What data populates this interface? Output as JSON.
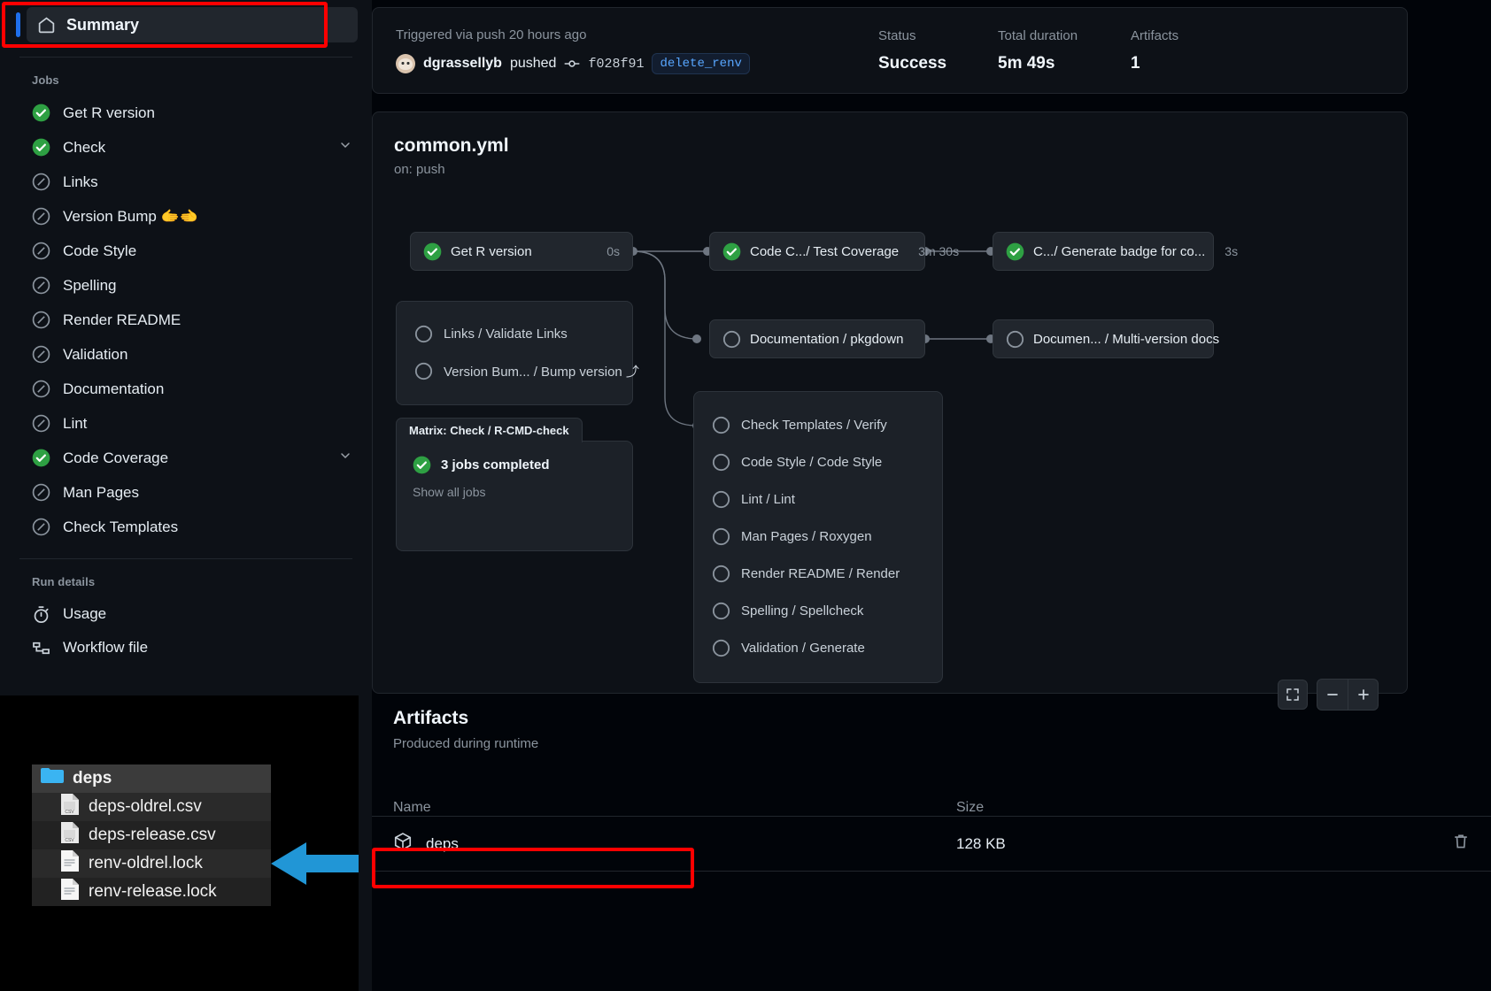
{
  "sidebar": {
    "summary": {
      "label": "Summary",
      "icon": "home-icon"
    },
    "jobs_heading": "Jobs",
    "jobs": [
      {
        "label": "Get R version",
        "status": "success",
        "expandable": false
      },
      {
        "label": "Check",
        "status": "success",
        "expandable": true
      },
      {
        "label": "Links",
        "status": "skipped",
        "expandable": false
      },
      {
        "label": "Version Bump 🫱🫲",
        "status": "skipped",
        "expandable": false
      },
      {
        "label": "Code Style",
        "status": "skipped",
        "expandable": false
      },
      {
        "label": "Spelling",
        "status": "skipped",
        "expandable": false
      },
      {
        "label": "Render README",
        "status": "skipped",
        "expandable": false
      },
      {
        "label": "Validation",
        "status": "skipped",
        "expandable": false
      },
      {
        "label": "Documentation",
        "status": "skipped",
        "expandable": false
      },
      {
        "label": "Lint",
        "status": "skipped",
        "expandable": false
      },
      {
        "label": "Code Coverage",
        "status": "success",
        "expandable": true
      },
      {
        "label": "Man Pages",
        "status": "skipped",
        "expandable": false
      },
      {
        "label": "Check Templates",
        "status": "skipped",
        "expandable": false
      }
    ],
    "run_details_heading": "Run details",
    "run_details": [
      {
        "label": "Usage",
        "icon": "stopwatch-icon"
      },
      {
        "label": "Workflow file",
        "icon": "workflow-file-icon"
      }
    ]
  },
  "finder": {
    "rows": [
      {
        "name": "deps",
        "type": "folder",
        "depth": 0
      },
      {
        "name": "deps-oldrel.csv",
        "type": "csv",
        "depth": 1
      },
      {
        "name": "deps-release.csv",
        "type": "csv",
        "depth": 1
      },
      {
        "name": "renv-oldrel.lock",
        "type": "file",
        "depth": 1
      },
      {
        "name": "renv-release.lock",
        "type": "file",
        "depth": 1
      }
    ]
  },
  "header": {
    "triggered": "Triggered via push 20 hours ago",
    "user": "dgrassellyb",
    "pushed_verb": "pushed",
    "commit_sha": "f028f91",
    "branch": "delete_renv",
    "status_label": "Status",
    "status_value": "Success",
    "duration_label": "Total duration",
    "duration_value": "5m 49s",
    "artifacts_label": "Artifacts",
    "artifacts_value": "1"
  },
  "workflow": {
    "file": "common.yml",
    "trigger": "on: push",
    "nodes": [
      {
        "id": "get-r-version",
        "label": "Get R version",
        "duration": "0s",
        "status": "success"
      },
      {
        "id": "test-coverage",
        "label": "Code C.../ Test Coverage",
        "duration": "3m 30s",
        "status": "success"
      },
      {
        "id": "generate-badge",
        "label": "C.../ Generate badge for co...",
        "duration": "3s",
        "status": "success"
      },
      {
        "id": "pkgdown",
        "label": "Documentation / pkgdown",
        "duration": "",
        "status": "skipped"
      },
      {
        "id": "multi-version-docs",
        "label": "Documen... / Multi-version docs",
        "duration": "",
        "status": "skipped"
      }
    ],
    "group_links": [
      {
        "label": "Links / Validate Links",
        "status": "skipped"
      },
      {
        "label": "Version Bum... / Bump version ⤴",
        "status": "skipped"
      }
    ],
    "matrix": {
      "tab_label": "Matrix: Check / R-CMD-check",
      "completed": "3 jobs completed",
      "show_all": "Show all jobs"
    },
    "group_checks": [
      {
        "label": "Check Templates / Verify",
        "status": "skipped"
      },
      {
        "label": "Code Style / Code Style",
        "status": "skipped"
      },
      {
        "label": "Lint / Lint",
        "status": "skipped"
      },
      {
        "label": "Man Pages / Roxygen",
        "status": "skipped"
      },
      {
        "label": "Render README / Render",
        "status": "skipped"
      },
      {
        "label": "Spelling / Spellcheck",
        "status": "skipped"
      },
      {
        "label": "Validation / Generate",
        "status": "skipped"
      }
    ],
    "controls": {
      "fullscreen": "fullscreen-icon",
      "zoom_out": "zoom-out-icon",
      "zoom_in": "zoom-in-icon"
    }
  },
  "artifacts": {
    "title": "Artifacts",
    "subtitle": "Produced during runtime",
    "col_name": "Name",
    "col_size": "Size",
    "rows": [
      {
        "name": "deps",
        "size": "128 KB",
        "icon": "package-icon",
        "delete_icon": "trash-icon"
      }
    ]
  },
  "annotations": {
    "accent_red": "#ff0000",
    "accent_blue": "#2196d6",
    "selected_blue": "#1f6feb",
    "success_green": "#2ea043"
  }
}
